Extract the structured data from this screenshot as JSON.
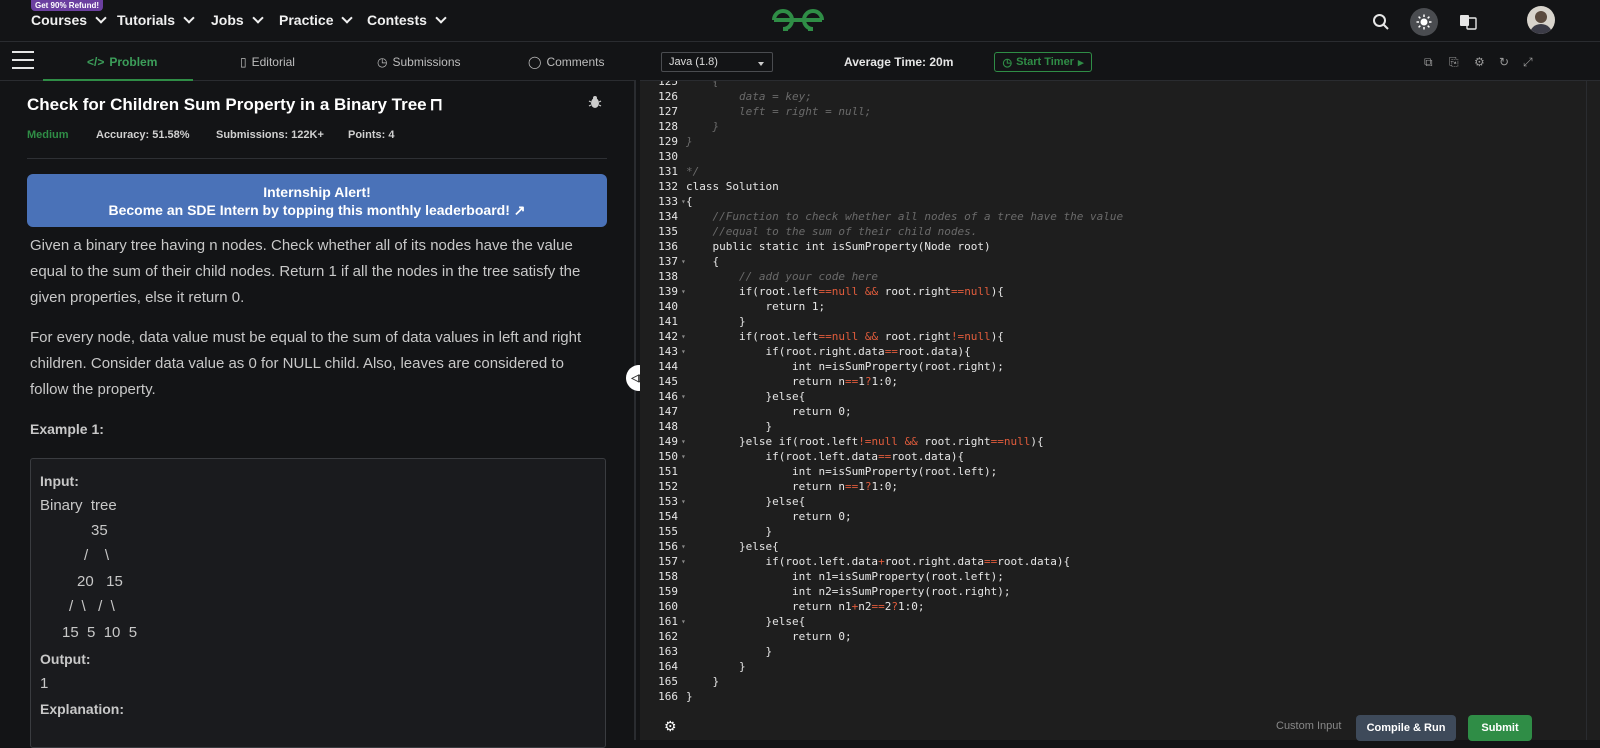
{
  "promo": "Get 90% Refund!",
  "nav": [
    {
      "label": "Courses"
    },
    {
      "label": "Tutorials"
    },
    {
      "label": "Jobs"
    },
    {
      "label": "Practice"
    },
    {
      "label": "Contests"
    }
  ],
  "tabs": [
    {
      "label": "Problem",
      "icon": "code-icon"
    },
    {
      "label": "Editorial",
      "icon": "document-icon"
    },
    {
      "label": "Submissions",
      "icon": "clock-icon"
    },
    {
      "label": "Comments",
      "icon": "comment-icon"
    }
  ],
  "problem": {
    "title": "Check for Children Sum Property in a Binary Tree",
    "difficulty": "Medium",
    "accuracy": "Accuracy: 51.58%",
    "submissions": "Submissions: 122K+",
    "points": "Points: 4",
    "alert_line1": "Internship Alert!",
    "alert_line2": "Become an SDE Intern by topping this monthly leaderboard!",
    "desc_p1_l1": "Given a binary tree having n nodes. Check whether all of its nodes have the value",
    "desc_p1_l2": "equal to the sum of their child nodes. Return 1 if all the nodes in the tree satisfy the",
    "desc_p1_l3": "given properties, else it return 0.",
    "desc_p2_l1": "For every node, data value must be equal to the sum of data values in left and right",
    "desc_p2_l2": "children. Consider data value as 0 for NULL child.  Also, leaves are considered to",
    "desc_p2_l3": "follow the property.",
    "example_title": "Example 1:",
    "input_label": "Input:",
    "binary_tree": "Binary  tree",
    "tree_l1": "35",
    "tree_l2": "/    \\",
    "tree_l3": "20   15",
    "tree_l4": "/  \\   /  \\",
    "tree_l5": "15  5  10  5",
    "output_label": "Output:",
    "output_value": "1",
    "explanation_label": "Explanation:"
  },
  "editor": {
    "language": "Java (1.8)",
    "avg_time": "Average Time: 20m",
    "start_timer": "Start Timer",
    "custom_input": "Custom Input",
    "compile_run": "Compile & Run",
    "submit": "Submit",
    "lines": [
      {
        "n": "125",
        "t": "    {",
        "c": true
      },
      {
        "n": "126",
        "t": "        data = key;",
        "c": true
      },
      {
        "n": "127",
        "t": "        left = right = null;",
        "c": true
      },
      {
        "n": "128",
        "t": "    }",
        "c": true
      },
      {
        "n": "129",
        "t": "}",
        "c": true
      },
      {
        "n": "130",
        "t": ""
      },
      {
        "n": "131",
        "t": "*/",
        "c": true
      },
      {
        "n": "132",
        "t": "class Solution"
      },
      {
        "n": "133",
        "t": "{",
        "f": true
      },
      {
        "n": "134",
        "t": "    //Function to check whether all nodes of a tree have the value",
        "c": true
      },
      {
        "n": "135",
        "t": "    //equal to the sum of their child nodes.",
        "c": true
      },
      {
        "n": "136",
        "t": "    public static int isSumProperty(Node root)"
      },
      {
        "n": "137",
        "t": "    {",
        "f": true
      },
      {
        "n": "138",
        "t": "        // add your code here",
        "c": true
      },
      {
        "n": "139",
        "t": "        if(root.left==null && root.right==null){",
        "f": true
      },
      {
        "n": "140",
        "t": "            return 1;"
      },
      {
        "n": "141",
        "t": "        }"
      },
      {
        "n": "142",
        "t": "        if(root.left==null && root.right!=null){",
        "f": true
      },
      {
        "n": "143",
        "t": "            if(root.right.data==root.data){",
        "f": true
      },
      {
        "n": "144",
        "t": "                int n=isSumProperty(root.right);"
      },
      {
        "n": "145",
        "t": "                return n==1?1:0;"
      },
      {
        "n": "146",
        "t": "            }else{",
        "f": true
      },
      {
        "n": "147",
        "t": "                return 0;"
      },
      {
        "n": "148",
        "t": "            }"
      },
      {
        "n": "149",
        "t": "        }else if(root.left!=null && root.right==null){",
        "f": true
      },
      {
        "n": "150",
        "t": "            if(root.left.data==root.data){",
        "f": true
      },
      {
        "n": "151",
        "t": "                int n=isSumProperty(root.left);"
      },
      {
        "n": "152",
        "t": "                return n==1?1:0;"
      },
      {
        "n": "153",
        "t": "            }else{",
        "f": true
      },
      {
        "n": "154",
        "t": "                return 0;"
      },
      {
        "n": "155",
        "t": "            }"
      },
      {
        "n": "156",
        "t": "        }else{",
        "f": true
      },
      {
        "n": "157",
        "t": "            if(root.left.data+root.right.data==root.data){",
        "f": true
      },
      {
        "n": "158",
        "t": "                int n1=isSumProperty(root.left);"
      },
      {
        "n": "159",
        "t": "                int n2=isSumProperty(root.right);"
      },
      {
        "n": "160",
        "t": "                return n1+n2==2?1:0;"
      },
      {
        "n": "161",
        "t": "            }else{",
        "f": true
      },
      {
        "n": "162",
        "t": "                return 0;"
      },
      {
        "n": "163",
        "t": "            }"
      },
      {
        "n": "164",
        "t": "        }"
      },
      {
        "n": "165",
        "t": "    }"
      },
      {
        "n": "166",
        "t": "}"
      }
    ]
  },
  "colors": {
    "brand_green": "#2f8d46",
    "alert_blue": "#4a72b8",
    "keyword_red": "#e05c3c"
  }
}
